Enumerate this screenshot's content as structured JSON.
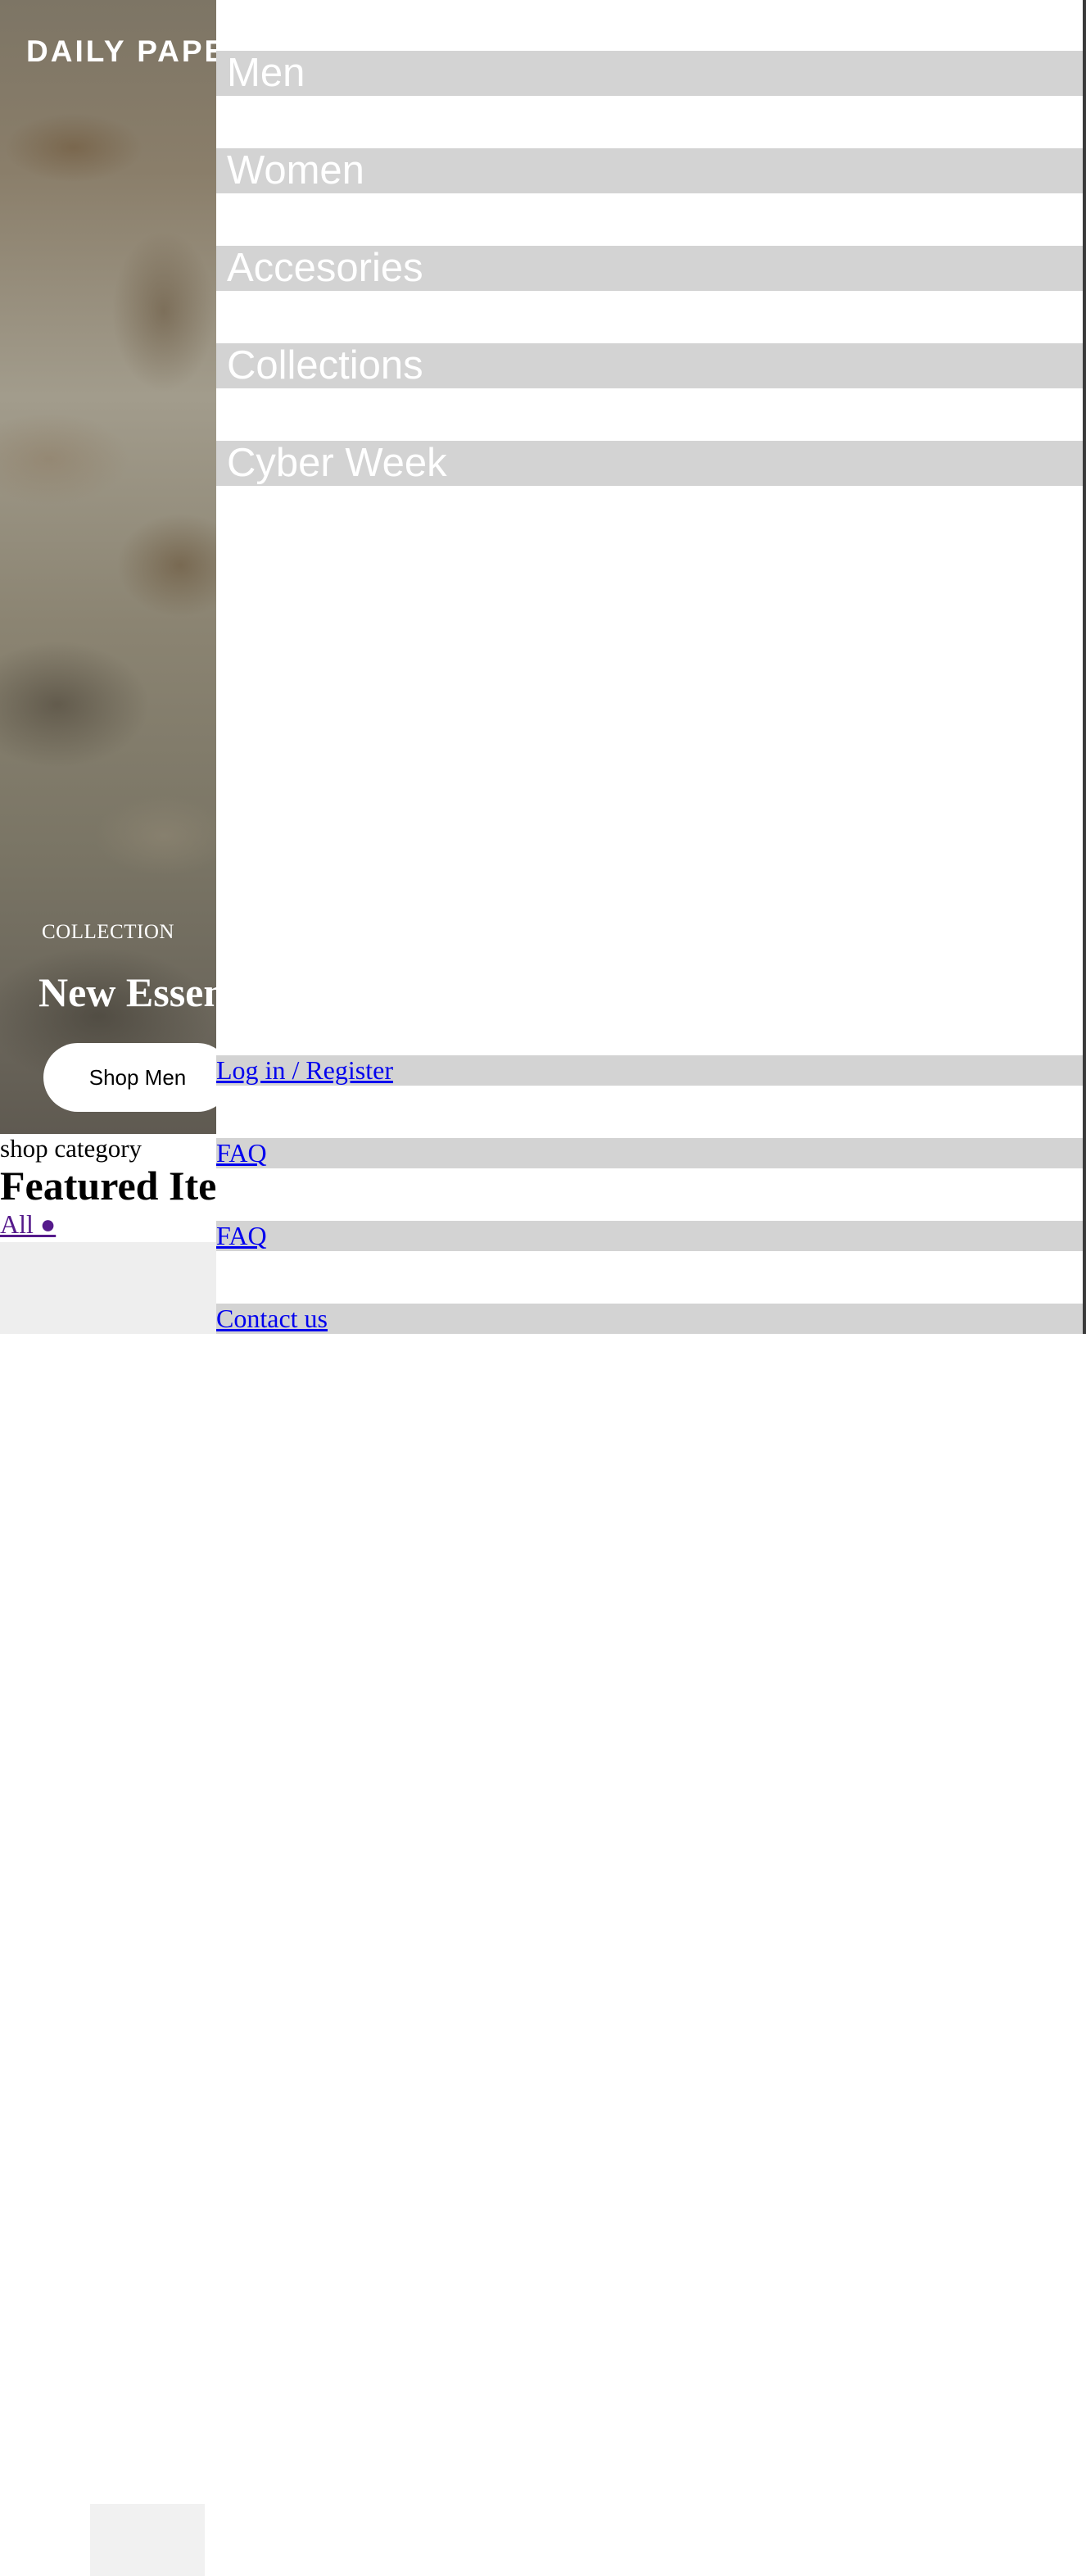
{
  "brand": {
    "logo_text": "DAILY PAPER"
  },
  "hero": {
    "kicker": "COLLECTION",
    "title": "New Essentials",
    "cta_label": "Shop Men"
  },
  "featured": {
    "kicker": "shop category",
    "title": "Featured Items",
    "filter_label": "All ●"
  },
  "drawer": {
    "nav_items": [
      {
        "label": "Men"
      },
      {
        "label": "Women"
      },
      {
        "label": "Accesories"
      },
      {
        "label": "Collections"
      },
      {
        "label": "Cyber Week"
      }
    ],
    "utility_links": [
      {
        "label": "Log in / Register"
      },
      {
        "label": "FAQ"
      },
      {
        "label": "FAQ"
      },
      {
        "label": "Contact us"
      }
    ]
  },
  "colors": {
    "drawer_item_bg": "#d3d3d3",
    "drawer_item_text": "#ffffff",
    "link": "#0000ee",
    "visited_link": "#551a8b"
  }
}
